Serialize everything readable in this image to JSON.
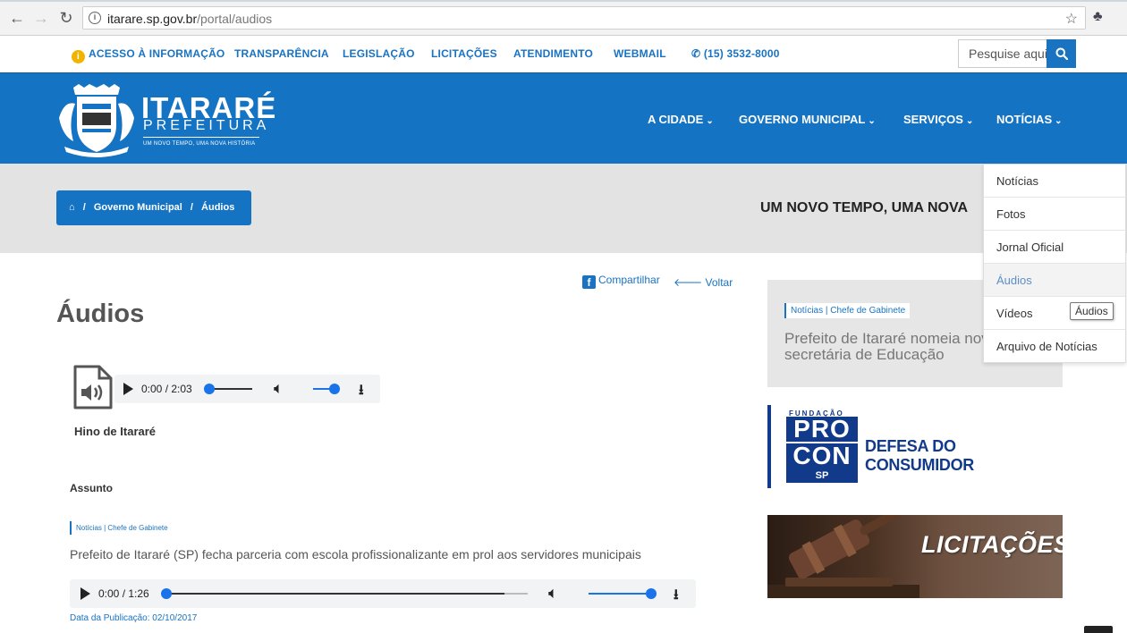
{
  "browser": {
    "url_host": "itarare.sp.gov.br",
    "url_path": "/portal/audios"
  },
  "topbar": {
    "items": [
      {
        "label": "ACESSO À INFORMAÇÃO"
      },
      {
        "label": "TRANSPARÊNCIA"
      },
      {
        "label": "LEGISLAÇÃO"
      },
      {
        "label": "LICITAÇÕES"
      },
      {
        "label": "ATENDIMENTO"
      },
      {
        "label": "WEBMAIL"
      },
      {
        "label": "(15) 3532-8000"
      }
    ],
    "search_placeholder": "Pesquise aqui"
  },
  "header": {
    "logo_title": "ITARARÉ",
    "logo_sub": "PREFEITURA",
    "logo_tagline": "UM NOVO TEMPO, UMA NOVA HISTÓRIA",
    "nav": [
      {
        "label": "A CIDADE"
      },
      {
        "label": "GOVERNO MUNICIPAL"
      },
      {
        "label": "SERVIÇOS"
      },
      {
        "label": "NOTÍCIAS"
      }
    ]
  },
  "breadcrumb": {
    "sep": "/",
    "level1": "Governo Municipal",
    "level2": "Áudios"
  },
  "slogan": "UM NOVO TEMPO, UMA NOVA",
  "dropdown": {
    "items": [
      {
        "label": "Notícias"
      },
      {
        "label": "Fotos"
      },
      {
        "label": "Jornal Oficial"
      },
      {
        "label": "Áudios"
      },
      {
        "label": "Vídeos"
      },
      {
        "label": "Arquivo de Notícias"
      }
    ],
    "active_index": 3,
    "tooltip": "Áudios"
  },
  "content": {
    "share_label": "Compartilhar",
    "back_label": "Voltar",
    "title": "Áudios",
    "player1": {
      "time": "0:00 / 2:03",
      "progress": 0.0,
      "volume": 1.0
    },
    "audio_name": "Hino de Itararé",
    "assunto_label": "Assunto",
    "tag": "Notícias | Chefe de Gabinete",
    "news_title": "Prefeito de Itararé (SP) fecha parceria com escola profissionalizante em prol aos servidores municipais",
    "player2": {
      "time": "0:00 / 1:26",
      "progress": 0.0,
      "volume": 1.0
    },
    "pub_date": "Data da Publicação: 02/10/2017"
  },
  "sidebar": {
    "news_tag": "Notícias | Chefe de Gabinete",
    "news_headline": "Prefeito de Itararé nomeia nova secretária de Educação",
    "procon": {
      "fundacao": "FUNDAÇÃO",
      "pro": "PRO",
      "con": "CON",
      "sp": "SP",
      "label": "DEFESA DO CONSUMIDOR"
    },
    "licitacoes_label": "LICITAÇÕES"
  },
  "colors": {
    "brand_blue": "#1573c3",
    "procon_blue": "#123a8b"
  }
}
